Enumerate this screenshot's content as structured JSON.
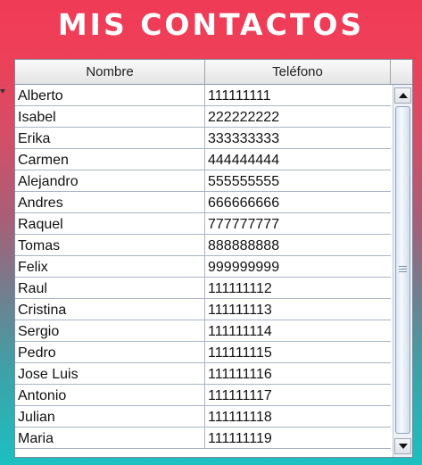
{
  "window": {
    "title": "MIS CONTACTOS"
  },
  "table": {
    "columns": [
      "Nombre",
      "Teléfono"
    ],
    "rows": [
      {
        "nombre": "Alberto",
        "telefono": "111111111"
      },
      {
        "nombre": "Isabel",
        "telefono": "222222222"
      },
      {
        "nombre": "Erika",
        "telefono": "333333333"
      },
      {
        "nombre": "Carmen",
        "telefono": "444444444"
      },
      {
        "nombre": "Alejandro",
        "telefono": "555555555"
      },
      {
        "nombre": "Andres",
        "telefono": "666666666"
      },
      {
        "nombre": "Raquel",
        "telefono": "777777777"
      },
      {
        "nombre": "Tomas",
        "telefono": "888888888"
      },
      {
        "nombre": "Felix",
        "telefono": "999999999"
      },
      {
        "nombre": "Raul",
        "telefono": "111111112"
      },
      {
        "nombre": "Cristina",
        "telefono": "111111113"
      },
      {
        "nombre": "Sergio",
        "telefono": "111111114"
      },
      {
        "nombre": "Pedro",
        "telefono": "111111115"
      },
      {
        "nombre": "Jose Luis",
        "telefono": "111111116"
      },
      {
        "nombre": "Antonio",
        "telefono": "111111117"
      },
      {
        "nombre": "Julian",
        "telefono": "111111118"
      },
      {
        "nombre": "Maria",
        "telefono": "111111119"
      }
    ]
  },
  "scrollbar": {
    "up_icon": "arrow-up-icon",
    "down_icon": "arrow-down-icon",
    "thumb_icon": "grip-icon"
  },
  "colors": {
    "gradient_top": "#f03a57",
    "gradient_bottom": "#1cc0c0",
    "title_text": "#ffffff"
  }
}
